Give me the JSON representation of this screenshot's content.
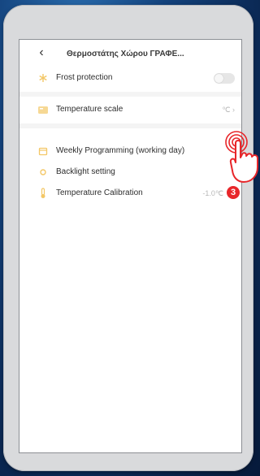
{
  "header": {
    "back_icon": "chevron-left-icon",
    "title": "Θερμοστάτης Χώρου ΓΡΑΦΕ..."
  },
  "settings": {
    "frost_protection": {
      "label": "Frost protection",
      "icon": "frost-icon",
      "enabled": false
    },
    "temperature_scale": {
      "label": "Temperature scale",
      "value": "℃ ›",
      "icon": "thermometer-scale-icon"
    },
    "weekly_programming": {
      "label": "Weekly Programming (working day)",
      "icon": "calendar-icon"
    },
    "backlight_setting": {
      "label": "Backlight setting",
      "icon": "sun-icon"
    },
    "temperature_calibration": {
      "label": "Temperature Calibration",
      "value": "-1.0℃",
      "icon": "thermometer-icon"
    }
  },
  "overlay": {
    "step_number": "3",
    "hand_icon": "tap-hand-icon",
    "ripple_icon": "tap-ripple-icon"
  },
  "colors": {
    "icon_accent": "#f3c766",
    "badge_red": "#e8262a",
    "background_blue": "#13427c"
  }
}
